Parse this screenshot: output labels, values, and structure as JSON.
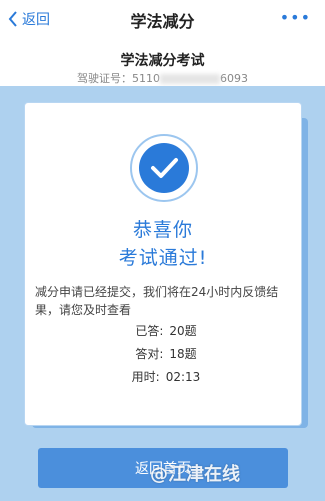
{
  "nav": {
    "back_label": "返回",
    "title": "学法减分",
    "more": "•••"
  },
  "exam": {
    "title": "学法减分考试",
    "license_label": "驾驶证号：",
    "license_prefix": "5110",
    "license_suffix": "6093"
  },
  "result": {
    "congrats_line1": "恭喜你",
    "congrats_line2": "考试通过!",
    "message": "减分申请已经提交，我们将在24小时内反馈结果，请您及时查看",
    "answered_label": "已答:",
    "answered_value": "20题",
    "correct_label": "答对:",
    "correct_value": "18题",
    "time_label": "用时:",
    "time_value": "02:13"
  },
  "button": {
    "label": "返回首页"
  },
  "watermark": "@江津在线",
  "colors": {
    "accent": "#2a7ad9",
    "panel": "#aed1ef",
    "button": "#4b8fdc"
  }
}
